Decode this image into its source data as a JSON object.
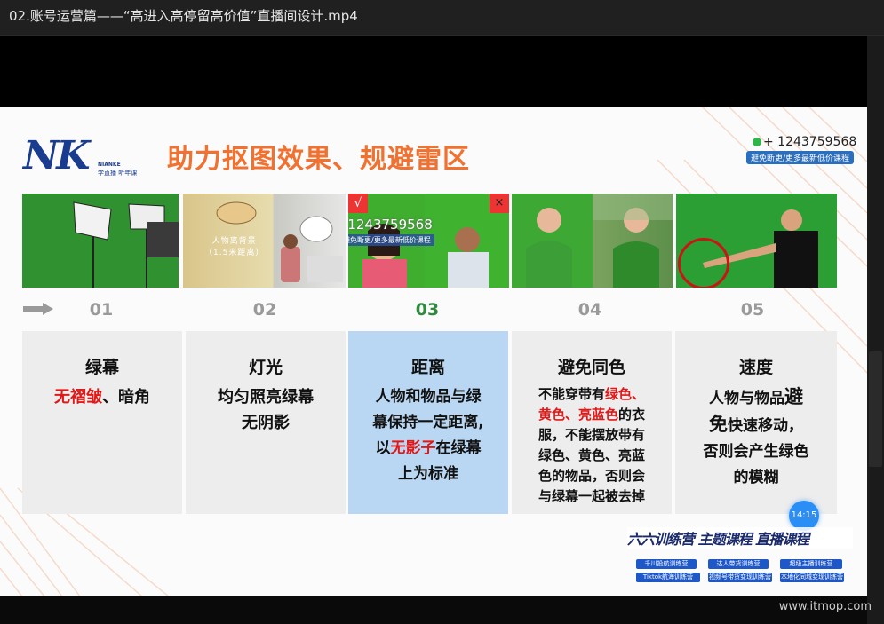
{
  "window": {
    "title": "02.账号运营篇——“高进入高停留高价值”直播间设计.mp4"
  },
  "slide": {
    "logo": {
      "main": "NK",
      "sub1": "NIANKE",
      "sub2": "学直播 听年课"
    },
    "title": "助力抠图效果、规避雷区",
    "contact": {
      "phone": "+ 1243759568",
      "note": "避免断更/更多最新低价课程"
    },
    "photos": [
      {
        "label": "",
        "caption": ""
      },
      {
        "label": "",
        "caption_line1": "人物离背景",
        "caption_line2": "（1.5米距离）"
      },
      {
        "check": "√",
        "cross": "×",
        "wm_phone": "+ 1243759568",
        "wm_note": "避免断更/更多最新低价课程"
      },
      {
        "label": ""
      },
      {
        "label": ""
      }
    ],
    "steps": [
      "01",
      "02",
      "03",
      "04",
      "05"
    ],
    "cards": [
      {
        "title": "绿幕",
        "red": "无褶皱",
        "rest": "、暗角"
      },
      {
        "title": "灯光",
        "line1": "均匀照亮绿幕",
        "line2": "无阴影"
      },
      {
        "title": "距离",
        "line1": "人物和物品与绿",
        "line2": "幕保持一定距离,",
        "pre3": "以",
        "red3": "无影子",
        "post3": "在绿幕",
        "line4": "上为标准"
      },
      {
        "title": "避免同色",
        "l1a": "不能穿带有",
        "l1r": "绿色、",
        "l2r": "黄色、亮蓝色",
        "l2b": "的衣",
        "l3": "服，不能摆放带有",
        "l4": "绿色、黄色、亮蓝",
        "l5": "色的物品，否则会",
        "l6": "与绿幕一起被去掉"
      },
      {
        "title": "速度",
        "line1a": "人物与物品",
        "line1b": "避",
        "line2a": "免",
        "line2b": "快速移动，",
        "line3": "否则会产生绿色",
        "line4": "的模糊"
      }
    ],
    "banner": {
      "title": "六六训练营 主题课程 直播课程",
      "badges": [
        "千川投航训练营",
        "达人带货训练营",
        "超级主播训练营",
        "Tiktok航海训练营",
        "视频号带货变现训练营",
        "本地化同城变现训练营"
      ]
    },
    "timer": "14:15"
  },
  "watermark": "www.itmop.com",
  "colors": {
    "accent": "#f07130",
    "logo": "#1a3c8f",
    "active_step": "#2e8b3e",
    "highlight_card": "#b9d7f3",
    "red": "#e01818"
  }
}
